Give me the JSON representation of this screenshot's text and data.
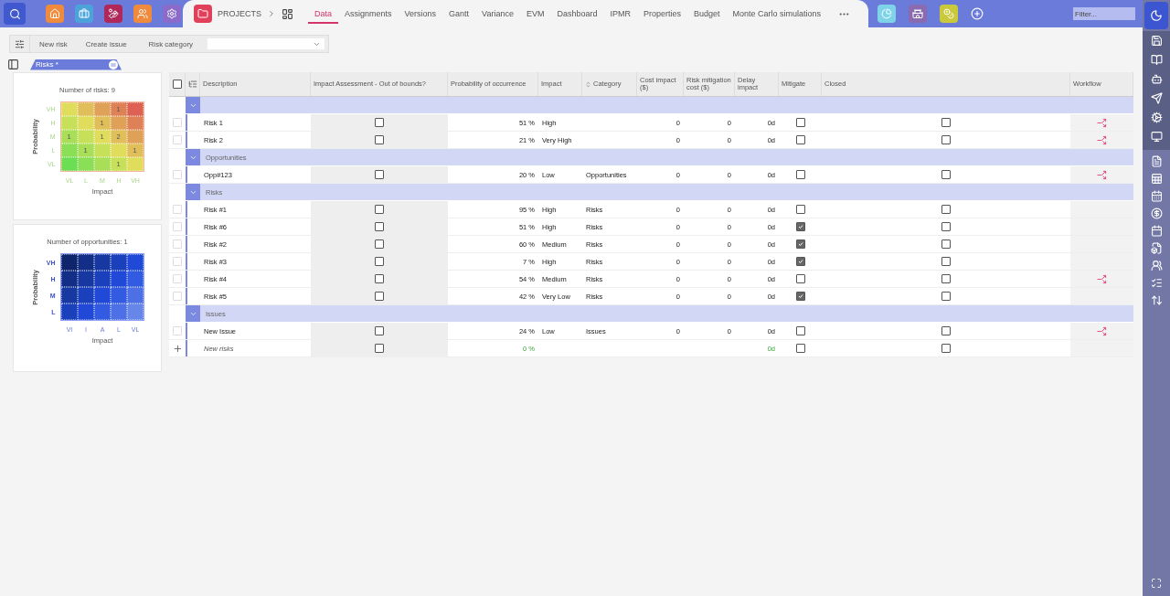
{
  "app_bar": {
    "breadcrumb": "PROJECTS",
    "tabs": [
      {
        "label": "Data",
        "selected": true
      },
      {
        "label": "Assignments",
        "selected": false
      },
      {
        "label": "Versions",
        "selected": false
      },
      {
        "label": "Gantt",
        "selected": false
      },
      {
        "label": "Variance",
        "selected": false
      },
      {
        "label": "EVM",
        "selected": false
      },
      {
        "label": "Dashboard",
        "selected": false
      },
      {
        "label": "IPMR",
        "selected": false
      },
      {
        "label": "Properties",
        "selected": false
      },
      {
        "label": "Budget",
        "selected": false
      },
      {
        "label": "Monte Carlo simulations",
        "selected": false
      }
    ],
    "filter": {
      "placeholder": "Filter..."
    }
  },
  "toolbar": {
    "buttons": [
      "New risk",
      "Create issue"
    ],
    "category_label": "Risk category"
  },
  "view_tab": {
    "label": "Risks *"
  },
  "risk_matrix": {
    "title": "Number of risks: 9",
    "y_label": "Probability",
    "x_label": "Impact",
    "rows": [
      "VH",
      "H",
      "M",
      "L",
      "VL"
    ],
    "columns": [
      "VL",
      "L",
      "M",
      "H",
      "VH"
    ],
    "cells": [
      [
        {},
        {},
        {},
        {
          "count": "1"
        },
        {}
      ],
      [
        {},
        {},
        {
          "count": "1"
        },
        {},
        {}
      ],
      [
        {
          "count": "1"
        },
        {},
        {
          "count": "1"
        },
        {
          "count": "2"
        },
        {}
      ],
      [
        {},
        {
          "count": "1"
        },
        {},
        {},
        {
          "count": "1"
        }
      ],
      [
        {},
        {},
        {},
        {
          "count": "1"
        },
        {}
      ]
    ]
  },
  "opportunity_matrix": {
    "title": "Number of opportunities: 1",
    "y_label": "Probability",
    "x_label": "Impact",
    "rows": [
      "VH",
      "H",
      "M",
      "L"
    ],
    "columns": [
      "VI",
      "I",
      "A",
      "L",
      "VL"
    ]
  },
  "table": {
    "all_selected": false,
    "columns": [
      "Description",
      "Impact Assessment - Out of bounds?",
      "Probability of occurrence",
      "Impact",
      "Category",
      "Cost impact ($)",
      "Risk mitigation cost ($)",
      "Delay impact",
      "Mitigate",
      "Closed",
      "Workflow"
    ],
    "groups": [
      {
        "expanded": true,
        "rows": [
          {
            "selected": false,
            "description": "Risk 1",
            "out_of_bounds": false,
            "probability": "51 %",
            "impact": "High",
            "cost_impact": "0",
            "mitigation_cost": "0",
            "delay": "0d",
            "mitigate": false,
            "closed": false,
            "workflow": true
          },
          {
            "selected": false,
            "description": "Risk 2",
            "out_of_bounds": false,
            "probability": "21 %",
            "impact": "Very High",
            "cost_impact": "0",
            "mitigation_cost": "0",
            "delay": "0d",
            "mitigate": false,
            "closed": false,
            "workflow": true
          }
        ]
      },
      {
        "label": "Opportunities",
        "expanded": true,
        "rows": [
          {
            "selected": false,
            "description": "Opp#123",
            "out_of_bounds": false,
            "probability": "20 %",
            "impact": "Low",
            "category": "Opportunities",
            "cost_impact": "0",
            "mitigation_cost": "0",
            "delay": "0d",
            "mitigate": false,
            "closed": false,
            "workflow": true
          }
        ]
      },
      {
        "label": "Risks",
        "expanded": true,
        "rows": [
          {
            "selected": false,
            "description": "Risk #1",
            "out_of_bounds": false,
            "probability": "95 %",
            "impact": "High",
            "category": "Risks",
            "cost_impact": "0",
            "mitigation_cost": "0",
            "delay": "0d",
            "mitigate": false,
            "closed": false,
            "workflow": false
          },
          {
            "selected": false,
            "description": "Risk #6",
            "out_of_bounds": false,
            "probability": "51 %",
            "impact": "High",
            "category": "Risks",
            "cost_impact": "0",
            "mitigation_cost": "0",
            "delay": "0d",
            "mitigate": true,
            "closed": false,
            "workflow": false
          },
          {
            "selected": false,
            "description": "Risk #2",
            "out_of_bounds": false,
            "probability": "60 %",
            "impact": "Medium",
            "category": "Risks",
            "cost_impact": "0",
            "mitigation_cost": "0",
            "delay": "0d",
            "mitigate": true,
            "closed": false,
            "workflow": false
          },
          {
            "selected": false,
            "description": "Risk #3",
            "out_of_bounds": false,
            "probability": "7 %",
            "impact": "High",
            "category": "Risks",
            "cost_impact": "0",
            "mitigation_cost": "0",
            "delay": "0d",
            "mitigate": true,
            "closed": false,
            "workflow": false
          },
          {
            "selected": false,
            "description": "Risk #4",
            "out_of_bounds": false,
            "probability": "54 %",
            "impact": "Medium",
            "category": "Risks",
            "cost_impact": "0",
            "mitigation_cost": "0",
            "delay": "0d",
            "mitigate": false,
            "closed": false,
            "workflow": true
          },
          {
            "selected": false,
            "description": "Risk #5",
            "out_of_bounds": false,
            "probability": "42 %",
            "impact": "Very Low",
            "category": "Risks",
            "cost_impact": "0",
            "mitigation_cost": "0",
            "delay": "0d",
            "mitigate": true,
            "closed": false,
            "workflow": false
          }
        ]
      },
      {
        "label": "Issues",
        "expanded": true,
        "rows": [
          {
            "selected": false,
            "description": "New Issue",
            "out_of_bounds": false,
            "probability": "24 %",
            "impact": "Low",
            "category": "Issues",
            "cost_impact": "0",
            "mitigation_cost": "0",
            "delay": "0d",
            "mitigate": false,
            "closed": false,
            "workflow": true
          }
        ]
      }
    ],
    "new_row": {
      "placeholder": "New risks",
      "out_of_bounds": false,
      "probability": "0 %",
      "delay": "0d",
      "mitigate": false,
      "closed": false
    }
  }
}
